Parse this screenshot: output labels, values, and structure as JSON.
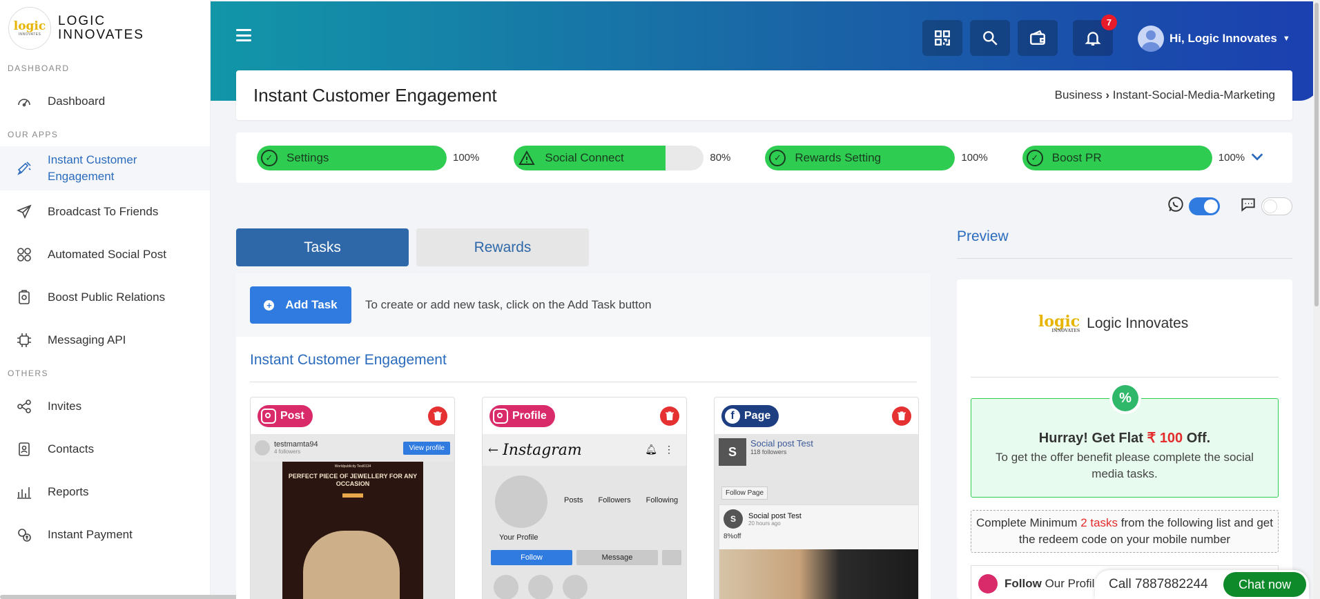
{
  "brand": {
    "logo_text": "logic",
    "logo_sub": "INNOVATES",
    "name_line1": "LOGIC",
    "name_line2": "INNOVATES"
  },
  "sidebar": {
    "sections": [
      "DASHBOARD",
      "OUR APPS",
      "OTHERS"
    ],
    "items": [
      {
        "label": "Dashboard",
        "icon": "gauge-icon"
      },
      {
        "label": "Instant Customer Engagement",
        "icon": "megaphone-icon",
        "active": true
      },
      {
        "label": "Broadcast To Friends",
        "icon": "paper-plane-icon"
      },
      {
        "label": "Automated Social Post",
        "icon": "social-grid-icon"
      },
      {
        "label": "Boost Public Relations",
        "icon": "clipboard-badge-icon"
      },
      {
        "label": "Messaging API",
        "icon": "api-chip-icon"
      },
      {
        "label": "Invites",
        "icon": "share-nodes-icon"
      },
      {
        "label": "Contacts",
        "icon": "contact-card-icon"
      },
      {
        "label": "Reports",
        "icon": "bar-report-icon"
      },
      {
        "label": "Instant Payment",
        "icon": "payment-icon"
      }
    ]
  },
  "header": {
    "notification_count": "7",
    "greeting": "Hi, Logic Innovates",
    "buttons": [
      "qr-code-icon",
      "search-icon",
      "wallet-icon",
      "bell-icon"
    ]
  },
  "page": {
    "title": "Instant Customer Engagement",
    "breadcrumb_root": "Business",
    "breadcrumb_sep": "›",
    "breadcrumb_current": "Instant-Social-Media-Marketing"
  },
  "progress": [
    {
      "label": "Settings",
      "value": "100%",
      "fraction": 1.0,
      "state": "done"
    },
    {
      "label": "Social Connect",
      "value": "80%",
      "fraction": 0.8,
      "state": "warning"
    },
    {
      "label": "Rewards Setting",
      "value": "100%",
      "fraction": 1.0,
      "state": "done"
    },
    {
      "label": "Boost PR",
      "value": "100%",
      "fraction": 1.0,
      "state": "done"
    }
  ],
  "toggles": {
    "whatsapp_on": true,
    "chat_on": false
  },
  "tabs": {
    "tasks": "Tasks",
    "rewards": "Rewards"
  },
  "tasks": {
    "add_label": "Add Task",
    "hint": "To create or add new task, click on the Add Task button",
    "section_title": "Instant Customer Engagement",
    "cards": [
      {
        "type": "Post",
        "username": "testmamta94",
        "followers": "4 followers",
        "view_profile": "View profile",
        "poster_top": "Worldpublicity Test0134",
        "poster_title": "PERFECT PIECE OF JEWELLERY FOR ANY OCCASION"
      },
      {
        "type": "Profile",
        "app_name": "Instagram",
        "stats": [
          "Posts",
          "Followers",
          "Following"
        ],
        "your_profile": "Your Profile",
        "follow": "Follow",
        "message": "Message"
      },
      {
        "type": "Page",
        "page_name": "Social post Test",
        "page_followers": "118 followers",
        "follow_page": "Follow Page",
        "post_name": "Social post Test",
        "post_time": "20 hours ago",
        "post_text": "8%off"
      }
    ]
  },
  "preview": {
    "title": "Preview",
    "logo_text": "logic",
    "logo_sub": "INNOVATES",
    "brand_name": "Logic Innovates",
    "offer_prefix": "Hurray! Get Flat",
    "offer_currency": "₹",
    "offer_amount": "100",
    "offer_suffix": "Off.",
    "offer_desc": "To get the offer benefit please complete the social media tasks.",
    "min_prefix": "Complete Minimum",
    "min_tasks": "2 tasks",
    "min_suffix": "from the following list and get the redeem code on your mobile number",
    "follow_bold": "Follow",
    "follow_rest": "Our Profil"
  },
  "chat": {
    "call": "Call 7887882244",
    "button": "Chat now"
  },
  "colors": {
    "accent": "#2f7be0",
    "progress": "#2fcc52",
    "danger": "#e53131",
    "instagram": "#d92a6a",
    "facebook": "#1d3f82"
  }
}
